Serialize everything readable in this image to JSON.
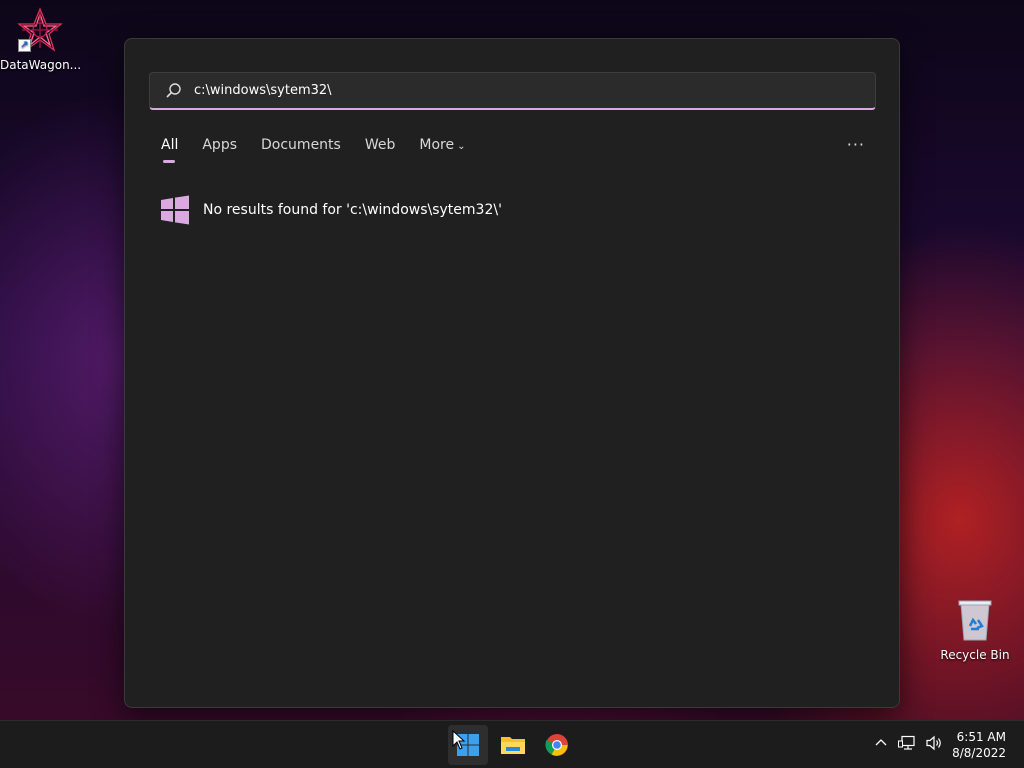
{
  "desktop": {
    "shortcut_label": "DataWagon...",
    "recycle_label": "Recycle Bin"
  },
  "search": {
    "query": "c:\\windows\\sytem32\\",
    "tabs": [
      {
        "label": "All"
      },
      {
        "label": "Apps"
      },
      {
        "label": "Documents"
      },
      {
        "label": "Web"
      },
      {
        "label": "More"
      }
    ],
    "more_dots": "···",
    "no_results": "No results found for 'c:\\windows\\sytem32\\'"
  },
  "taskbar": {
    "apps": [
      "start-icon",
      "file-explorer-icon",
      "chrome-icon"
    ],
    "time": "6:51 AM",
    "date": "8/8/2022"
  },
  "colors": {
    "accent": "#d9a9e0",
    "panel": "#202020",
    "taskbar": "#1c1c1c"
  }
}
